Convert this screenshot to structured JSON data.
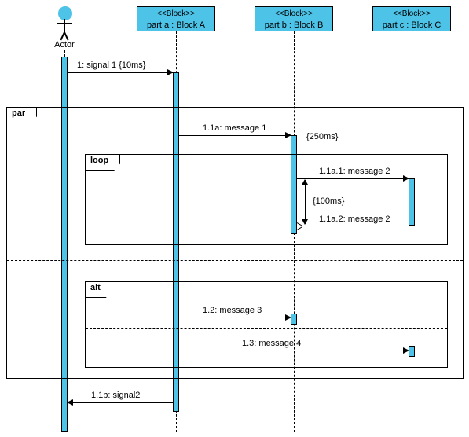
{
  "participants": {
    "actor": {
      "label": "Actor"
    },
    "a": {
      "stereotype": "<<Block>>",
      "label": "part a : Block A"
    },
    "b": {
      "stereotype": "<<Block>>",
      "label": "part b : Block B"
    },
    "c": {
      "stereotype": "<<Block>>",
      "label": "part c : Block C"
    }
  },
  "fragments": {
    "par": {
      "tag": "par"
    },
    "loop": {
      "tag": "loop"
    },
    "alt": {
      "tag": "alt"
    }
  },
  "messages": {
    "m1": {
      "label": "1: signal 1 {10ms}"
    },
    "m11a": {
      "label": "1.1a: message 1"
    },
    "c250": {
      "label": "{250ms}"
    },
    "m11a1": {
      "label": "1.1a.1: message 2"
    },
    "c100": {
      "label": "{100ms}"
    },
    "m11a2": {
      "label": "1.1a.2: message 2"
    },
    "m12": {
      "label": "1.2: message 3"
    },
    "m13": {
      "label": "1.3: message 4"
    },
    "m11b": {
      "label": "1.1b: signal2"
    }
  },
  "chart_data": {
    "type": "uml_sequence",
    "participants": [
      {
        "id": "actor",
        "name": "Actor",
        "kind": "actor"
      },
      {
        "id": "a",
        "name": "part a : Block A",
        "stereotype": "Block"
      },
      {
        "id": "b",
        "name": "part b : Block B",
        "stereotype": "Block"
      },
      {
        "id": "c",
        "name": "part c : Block C",
        "stereotype": "Block"
      }
    ],
    "interactions": [
      {
        "seq": "1",
        "from": "actor",
        "to": "a",
        "label": "signal 1",
        "constraint": "10ms"
      },
      {
        "fragment": "par",
        "operands": [
          {
            "interactions": [
              {
                "seq": "1.1a",
                "from": "a",
                "to": "b",
                "label": "message 1",
                "constraint_after": "250ms"
              },
              {
                "fragment": "loop",
                "operands": [
                  {
                    "interactions": [
                      {
                        "seq": "1.1a.1",
                        "from": "b",
                        "to": "c",
                        "label": "message 2"
                      },
                      {
                        "constraint_between": "100ms"
                      },
                      {
                        "seq": "1.1a.2",
                        "from": "c",
                        "to": "b",
                        "label": "message 2",
                        "dashed": true
                      }
                    ]
                  }
                ]
              }
            ]
          },
          {
            "interactions": [
              {
                "fragment": "alt",
                "operands": [
                  {
                    "interactions": [
                      {
                        "seq": "1.2",
                        "from": "a",
                        "to": "b",
                        "label": "message 3"
                      }
                    ]
                  },
                  {
                    "interactions": [
                      {
                        "seq": "1.3",
                        "from": "a",
                        "to": "c",
                        "label": "message 4"
                      }
                    ]
                  }
                ]
              }
            ]
          }
        ]
      },
      {
        "seq": "1.1b",
        "from": "a",
        "to": "actor",
        "label": "signal2"
      }
    ]
  }
}
